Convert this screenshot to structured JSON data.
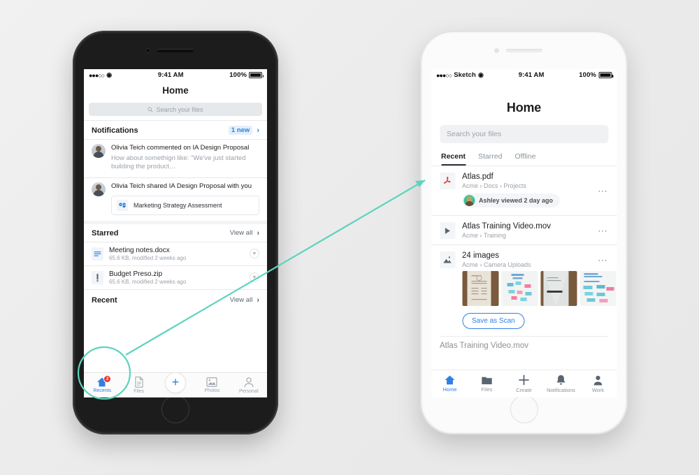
{
  "left_phone": {
    "frame_color": "#262626",
    "status_bar": {
      "signal_dots": "●●●○○",
      "carrier": "",
      "wifi_icon": "wifi-icon",
      "time": "9:41 AM",
      "battery": "100%"
    },
    "nav_title": "Home",
    "search": {
      "placeholder": "Search your files",
      "icon": "search-icon"
    },
    "notifications_section": {
      "title": "Notifications",
      "badge": "1 new",
      "chevron": "chevron-right-icon",
      "items": [
        {
          "avatar": "avatar",
          "title": "Olivia Teich commented on IA Design Proposal",
          "subtitle": "How about somethign like: \"We've just started building the product…"
        },
        {
          "avatar": "avatar",
          "title": "Olivia Teich shared IA Design Proposal with you",
          "card_icon": "dropbox-icon",
          "card_label": "Marketing Strategy Assessment"
        }
      ]
    },
    "starred_section": {
      "title": "Starred",
      "action": "View all",
      "chevron": "chevron-right-icon",
      "files": [
        {
          "icon": "doc-icon",
          "name": "Meeting notes.docx",
          "meta": "65.6 KB, modified 2 weeks ago",
          "caret": "chevron-down-icon"
        },
        {
          "icon": "zip-icon",
          "name": "Budget Preso.zip",
          "meta": "65.6 KB, modified 2 weeks ago",
          "caret": "chevron-down-icon"
        }
      ]
    },
    "recent_section": {
      "title": "Recent",
      "action": "View all",
      "chevron": "chevron-right-icon"
    },
    "tabbar": [
      {
        "icon": "home-icon",
        "label": "Recents",
        "active": true,
        "badge": "2"
      },
      {
        "icon": "files-icon",
        "label": "Files",
        "active": false
      },
      {
        "icon": "plus-icon",
        "label": "",
        "active": false,
        "is_fab": true
      },
      {
        "icon": "photos-icon",
        "label": "Photos",
        "active": false
      },
      {
        "icon": "person-icon",
        "label": "Personal",
        "active": false
      }
    ]
  },
  "right_phone": {
    "frame_color": "#f7f7f7",
    "status_bar": {
      "signal_dots": "●●●○○",
      "carrier": "Sketch",
      "wifi_icon": "wifi-icon",
      "time": "9:41 AM",
      "battery": "100%"
    },
    "title": "Home",
    "search": {
      "placeholder": "Search your files"
    },
    "tabs": [
      {
        "label": "Recent",
        "active": true
      },
      {
        "label": "Starred",
        "active": false
      },
      {
        "label": "Offline",
        "active": false
      }
    ],
    "rows": [
      {
        "icon": "pdf-icon",
        "name": "Atlas.pdf",
        "path": "Acme › Docs › Projects",
        "menu": "overflow-menu-icon",
        "viewed_by": "Ashley viewed 2 day ago",
        "viewer_avatar": "avatar"
      },
      {
        "icon": "video-icon",
        "name": "Atlas Training Video.mov",
        "path": "Acme › Training",
        "menu": "overflow-menu-icon"
      },
      {
        "icon": "images-icon",
        "name": "24 images",
        "path": "Acme › Camera Uploads",
        "menu": "overflow-menu-icon",
        "thumbnails": [
          {
            "name": "receipt-photo"
          },
          {
            "name": "whiteboard-stickies-photo"
          },
          {
            "name": "crumpled-paper-photo"
          },
          {
            "name": "whiteboard-diagram-photo"
          },
          {
            "name": "partial-photo"
          }
        ],
        "action_button": "Save as Scan"
      }
    ],
    "partial_row": "Atlas Training Video.mov",
    "tabbar": [
      {
        "icon": "home-icon",
        "label": "Home",
        "active": true
      },
      {
        "icon": "folder-icon",
        "label": "Files",
        "active": false
      },
      {
        "icon": "plus-icon",
        "label": "Create",
        "active": false
      },
      {
        "icon": "bell-icon",
        "label": "Notifications",
        "active": false
      },
      {
        "icon": "person-icon",
        "label": "Work",
        "active": false
      }
    ]
  },
  "annotation": {
    "color": "#5ed3bd",
    "shape": "circle-with-arrow",
    "target_left": "recents-tab",
    "target_right": "recent-tab"
  }
}
